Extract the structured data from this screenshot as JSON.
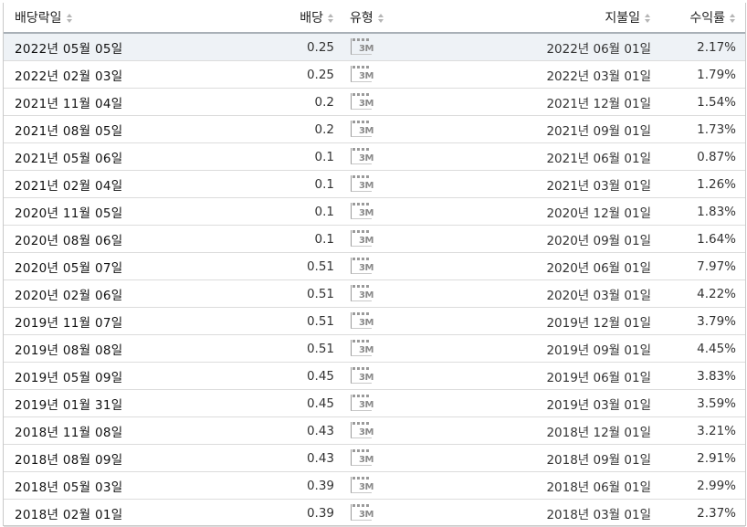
{
  "table": {
    "headers": {
      "ex_date": "배당락일",
      "dividend": "배당",
      "type": "유형",
      "pay_date": "지불일",
      "yield": "수익률"
    },
    "type_icon_label": "3M",
    "rows": [
      {
        "ex_date": "2022년 05월 05일",
        "dividend": "0.25",
        "pay_date": "2022년 06월 01일",
        "yield": "2.17%"
      },
      {
        "ex_date": "2022년 02월 03일",
        "dividend": "0.25",
        "pay_date": "2022년 03월 01일",
        "yield": "1.79%"
      },
      {
        "ex_date": "2021년 11월 04일",
        "dividend": "0.2",
        "pay_date": "2021년 12월 01일",
        "yield": "1.54%"
      },
      {
        "ex_date": "2021년 08월 05일",
        "dividend": "0.2",
        "pay_date": "2021년 09월 01일",
        "yield": "1.73%"
      },
      {
        "ex_date": "2021년 05월 06일",
        "dividend": "0.1",
        "pay_date": "2021년 06월 01일",
        "yield": "0.87%"
      },
      {
        "ex_date": "2021년 02월 04일",
        "dividend": "0.1",
        "pay_date": "2021년 03월 01일",
        "yield": "1.26%"
      },
      {
        "ex_date": "2020년 11월 05일",
        "dividend": "0.1",
        "pay_date": "2020년 12월 01일",
        "yield": "1.83%"
      },
      {
        "ex_date": "2020년 08월 06일",
        "dividend": "0.1",
        "pay_date": "2020년 09월 01일",
        "yield": "1.64%"
      },
      {
        "ex_date": "2020년 05월 07일",
        "dividend": "0.51",
        "pay_date": "2020년 06월 01일",
        "yield": "7.97%"
      },
      {
        "ex_date": "2020년 02월 06일",
        "dividend": "0.51",
        "pay_date": "2020년 03월 01일",
        "yield": "4.22%"
      },
      {
        "ex_date": "2019년 11월 07일",
        "dividend": "0.51",
        "pay_date": "2019년 12월 01일",
        "yield": "3.79%"
      },
      {
        "ex_date": "2019년 08월 08일",
        "dividend": "0.51",
        "pay_date": "2019년 09월 01일",
        "yield": "4.45%"
      },
      {
        "ex_date": "2019년 05월 09일",
        "dividend": "0.45",
        "pay_date": "2019년 06월 01일",
        "yield": "3.83%"
      },
      {
        "ex_date": "2019년 01월 31일",
        "dividend": "0.45",
        "pay_date": "2019년 03월 01일",
        "yield": "3.59%"
      },
      {
        "ex_date": "2018년 11월 08일",
        "dividend": "0.43",
        "pay_date": "2018년 12월 01일",
        "yield": "3.21%"
      },
      {
        "ex_date": "2018년 08월 09일",
        "dividend": "0.43",
        "pay_date": "2018년 09월 01일",
        "yield": "2.91%"
      },
      {
        "ex_date": "2018년 05월 03일",
        "dividend": "0.39",
        "pay_date": "2018년 06월 01일",
        "yield": "2.99%"
      },
      {
        "ex_date": "2018년 02월 01일",
        "dividend": "0.39",
        "pay_date": "2018년 03월 01일",
        "yield": "2.37%"
      }
    ]
  }
}
